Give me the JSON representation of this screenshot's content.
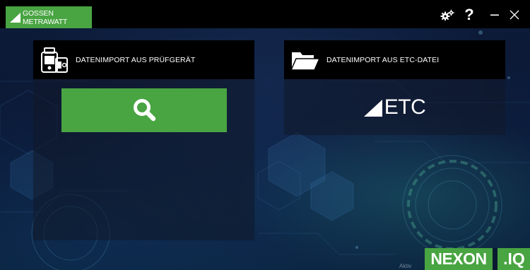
{
  "brand": {
    "name": "GOSSEN METRAWATT",
    "color": "#49a442"
  },
  "window_controls": {
    "settings_icon": "gears-icon",
    "help_label": "?",
    "minimize_icon": "minimize-icon",
    "close_icon": "close-icon"
  },
  "panels": [
    {
      "title": "DATENIMPORT AUS PRÜFGERÄT",
      "icon": "test-device-icon",
      "action_icon": "search-icon"
    },
    {
      "title": "DATENIMPORT AUS ETC-DATEI",
      "icon": "folder-open-icon",
      "action_label": "ETC"
    }
  ],
  "product_logo": {
    "main": "NEXON",
    "suffix": ".IQ"
  },
  "watermark": "Aktiv"
}
